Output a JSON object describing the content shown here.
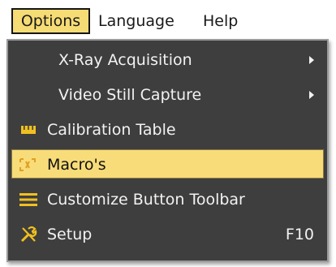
{
  "menubar": {
    "items": [
      {
        "label": "Options",
        "active": true
      },
      {
        "label": "Language"
      },
      {
        "label": "Help"
      }
    ]
  },
  "options_menu": {
    "items": [
      {
        "label": "X-Ray Acquisition",
        "submenu": true
      },
      {
        "label": "Video Still Capture",
        "submenu": true
      },
      {
        "label": "Calibration Table",
        "icon": "ruler-icon"
      },
      {
        "label": "Macro's",
        "icon": "macro-icon",
        "highlighted": true
      },
      {
        "label": "Customize Button Toolbar",
        "icon": "hamburger-icon"
      },
      {
        "label": "Setup",
        "icon": "tools-icon",
        "shortcut": "F10"
      }
    ]
  },
  "colors": {
    "menu_bg": "#3e3e3e",
    "highlight": "#f8dc79",
    "icon_accent": "#f0c020",
    "menu_text": "#f2f2f2"
  }
}
